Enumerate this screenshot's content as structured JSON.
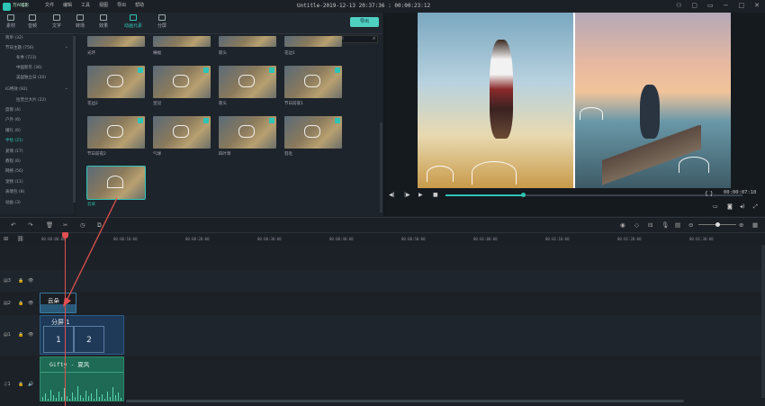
{
  "app": {
    "logo_text": "万兴喵影",
    "window_title": "Untitle-2019-12-13 20:37:36 : 00:00:23:12"
  },
  "menu": [
    "文件",
    "编辑",
    "工具",
    "视图",
    "导出",
    "帮助"
  ],
  "tabs": [
    "素材",
    "音频",
    "文字",
    "转场",
    "效果",
    "动画元素",
    "分屏"
  ],
  "export_label": "导出",
  "search_placeholder": "搜索",
  "sidebar": [
    "简单 (32)",
    "节日主题 (756)",
    "冬季 (723)",
    "中国新年 (36)",
    "美国独立日 (20)",
    "IG特效 (92)",
    "拉普兰大片 (22)",
    "度假 (4)",
    "户外 (6)",
    "婚礼 (6)",
    "手绘 (21)",
    "爱情 (17)",
    "教程 (6)",
    "网络 (56)",
    "宠物 (11)",
    "表情包 (8)",
    "动画 (3)"
  ],
  "sidebar_selected": "手绘 (21)",
  "library_items": [
    {
      "label": "光环",
      "row": 0
    },
    {
      "label": "横幅",
      "row": 0
    },
    {
      "label": "箭头",
      "row": 0
    },
    {
      "label": "花边1",
      "row": 0
    },
    {
      "label": "花边2",
      "row": 1
    },
    {
      "label": "皇冠",
      "row": 1
    },
    {
      "label": "箭头",
      "row": 1
    },
    {
      "label": "节日前夜1",
      "row": 1
    },
    {
      "label": "节日前夜2",
      "row": 2
    },
    {
      "label": "气球",
      "row": 2
    },
    {
      "label": "四叶草",
      "row": 2
    },
    {
      "label": "羽毛",
      "row": 2
    },
    {
      "label": "云朵",
      "row": 3
    }
  ],
  "preview": {
    "timecode": "00:00:07:10",
    "progress": 0.26,
    "bracket_text": "{ }"
  },
  "ruler_ticks": [
    "00:00:00:00",
    "00:00:10:00",
    "00:00:20:00",
    "00:00:30:00",
    "00:00:40:00",
    "00:00:50:00",
    "00:01:00:00",
    "00:01:10:00",
    "00:01:20:00",
    "00:01:30:00",
    "00:01:40:00",
    "00:01:50:00"
  ],
  "tracks": [
    {
      "id": "3"
    },
    {
      "id": "2"
    },
    {
      "id": "1"
    },
    {
      "id": "1"
    }
  ],
  "clips": {
    "overlay": {
      "label": "云朵"
    },
    "split": {
      "label": "分屏 1",
      "cell1": "1",
      "cell2": "2"
    },
    "audio": {
      "label": "Gifty - 夏风"
    }
  },
  "colors": {
    "accent": "#2ec4b6",
    "playhead": "#e05050",
    "arrow": "#e05050"
  }
}
